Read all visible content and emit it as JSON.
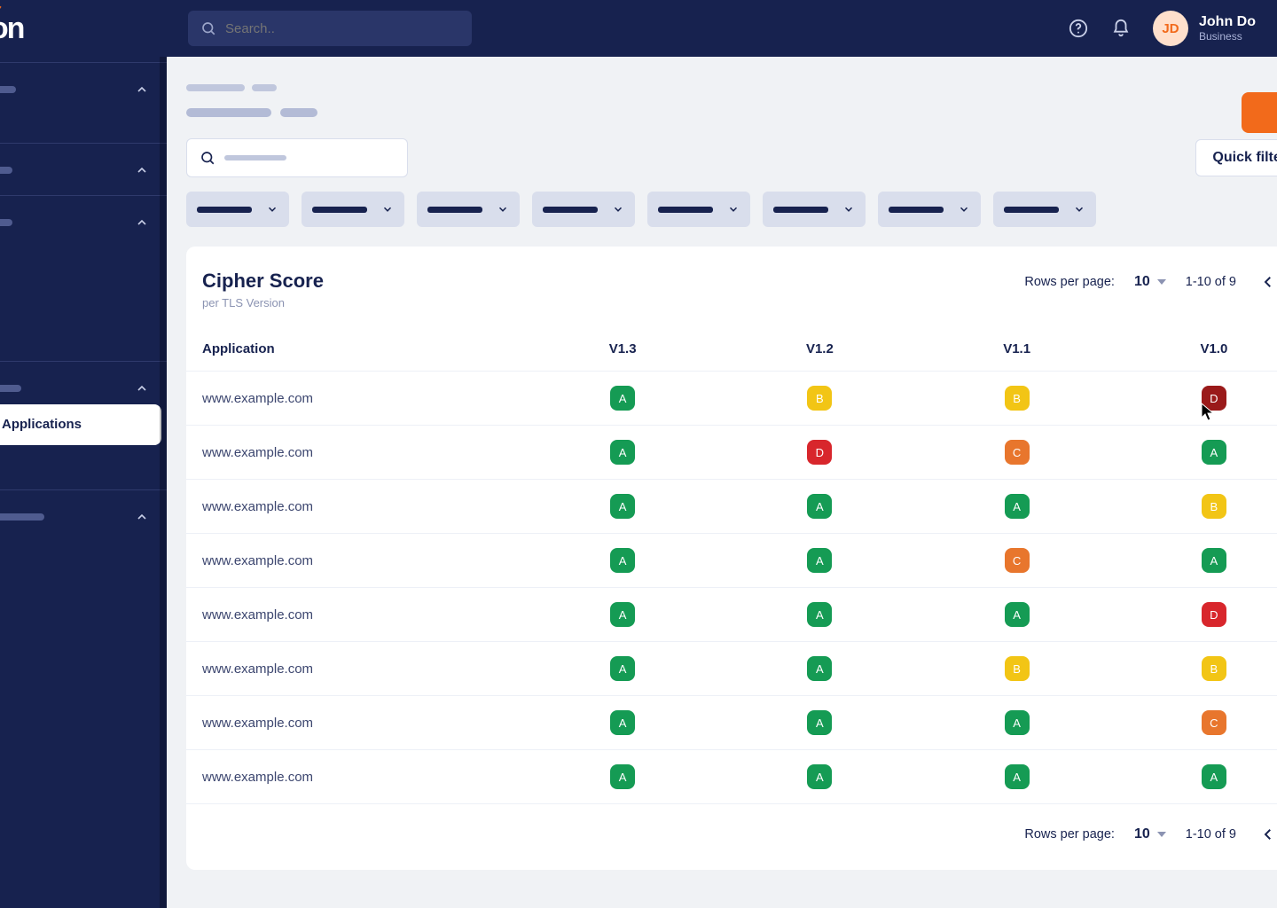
{
  "brand": {
    "name": "kon"
  },
  "topbar": {
    "search_placeholder": "Search..",
    "user": {
      "initials": "JD",
      "name": "John Do",
      "role": "Business"
    }
  },
  "sidebar": {
    "sections": [
      {
        "head_w": 28,
        "items": [
          50,
          90
        ]
      },
      {
        "head_w": 24,
        "items": []
      },
      {
        "head_w": 24,
        "items": [
          140,
          90,
          130,
          150,
          150,
          120,
          140,
          80
        ]
      },
      {
        "head_w": 34,
        "active_label": "Applications",
        "items_after": [
          60,
          90
        ]
      },
      {
        "head_w": 60,
        "items": [
          80,
          100
        ]
      }
    ]
  },
  "page": {
    "quick_filter_label": "Quick filter",
    "filter_chip_count": 8
  },
  "card": {
    "title": "Cipher Score",
    "subtitle": "per TLS Version",
    "pagination": {
      "rows_label": "Rows per page:",
      "rows_value": "10",
      "range": "1-10 of 9"
    },
    "columns": [
      "Application",
      "V1.3",
      "V1.2",
      "V1.1",
      "V1.0"
    ],
    "rows": [
      {
        "app": "www.example.com",
        "scores": [
          "A",
          "B",
          "B",
          "Dx"
        ]
      },
      {
        "app": "www.example.com",
        "scores": [
          "A",
          "D",
          "C",
          "A"
        ]
      },
      {
        "app": "www.example.com",
        "scores": [
          "A",
          "A",
          "A",
          "B"
        ]
      },
      {
        "app": "www.example.com",
        "scores": [
          "A",
          "A",
          "C",
          "A"
        ]
      },
      {
        "app": "www.example.com",
        "scores": [
          "A",
          "A",
          "A",
          "D"
        ]
      },
      {
        "app": "www.example.com",
        "scores": [
          "A",
          "A",
          "B",
          "B"
        ]
      },
      {
        "app": "www.example.com",
        "scores": [
          "A",
          "A",
          "A",
          "C"
        ]
      },
      {
        "app": "www.example.com",
        "scores": [
          "A",
          "A",
          "A",
          "A"
        ]
      }
    ],
    "score_display": {
      "A": "A",
      "B": "B",
      "C": "C",
      "D": "D",
      "Dx": "D"
    }
  }
}
